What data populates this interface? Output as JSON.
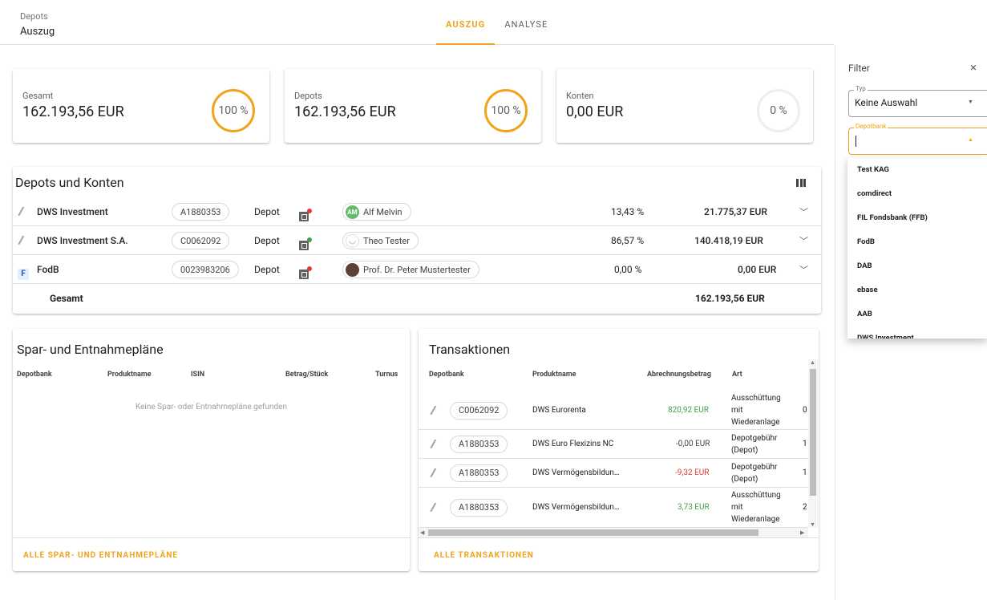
{
  "header": {
    "breadcrumb_small": "Depots",
    "breadcrumb_title": "Auszug",
    "tabs": [
      {
        "label": "AUSZUG",
        "active": true
      },
      {
        "label": "ANALYSE",
        "active": false
      }
    ]
  },
  "summary": [
    {
      "label": "Gesamt",
      "value": "162.193,56 EUR",
      "percent_label": "100 %"
    },
    {
      "label": "Depots",
      "value": "162.193,56 EUR",
      "percent_label": "100 %"
    },
    {
      "label": "Konten",
      "value": "0,00 EUR",
      "percent_label": "0 %"
    }
  ],
  "depots": {
    "title": "Depots und Konten",
    "rows": [
      {
        "name": "DWS Investment",
        "id": "A1880353",
        "type": "Depot",
        "status_color": "#e53935",
        "owner": "Alf Melvin",
        "owner_initials": "AM",
        "percent": "13,43 %",
        "amount": "21.775,37 EUR",
        "icon": "slash-icon"
      },
      {
        "name": "DWS Investment S.A.",
        "id": "C0062092",
        "type": "Depot",
        "status_color": "#43a047",
        "owner": "Theo Tester",
        "owner_initials": "◡",
        "percent": "86,57 %",
        "amount": "140.418,19 EUR",
        "icon": "slash-icon"
      },
      {
        "name": "FodB",
        "id": "0023983206",
        "type": "Depot",
        "status_color": "#e53935",
        "owner": "Prof. Dr. Peter Mustertester",
        "owner_initials": "",
        "percent": "0,00 %",
        "amount": "0,00 EUR",
        "icon": "f-icon",
        "icon_letter": "F"
      }
    ],
    "total_label": "Gesamt",
    "total_amount": "162.193,56 EUR"
  },
  "spar": {
    "title": "Spar- und Entnahmepläne",
    "columns": [
      "Depotbank",
      "Produktname",
      "ISIN",
      "Betrag/Stück",
      "Turnus"
    ],
    "empty_message": "Keine Spar- oder Entnahmepläne gefunden",
    "footer_link": "ALLE SPAR- UND ENTNAHMEPLÄNE"
  },
  "transactions": {
    "title": "Transaktionen",
    "columns": [
      "Depotbank",
      "Produktname",
      "Abrechnungsbetrag",
      "Art"
    ],
    "rows": [
      {
        "depot": "C0062092",
        "product": "DWS Eurorenta",
        "amount": "820,92 EUR",
        "amount_color": "#43a047",
        "art": [
          "Ausschüttung",
          "mit",
          "Wiederanlage"
        ],
        "extra": "0"
      },
      {
        "depot": "A1880353",
        "product": "DWS Euro Flexizins NC",
        "amount": "-0,00 EUR",
        "amount_color": "#424242",
        "art": [
          "Depotgebühr",
          "(Depot)"
        ],
        "extra": "1"
      },
      {
        "depot": "A1880353",
        "product": "DWS Vermögensbildun…",
        "amount": "-9,32 EUR",
        "amount_color": "#e53935",
        "art": [
          "Depotgebühr",
          "(Depot)"
        ],
        "extra": "1"
      },
      {
        "depot": "A1880353",
        "product": "DWS Vermögensbildun…",
        "amount": "3,73 EUR",
        "amount_color": "#43a047",
        "art": [
          "Ausschüttung",
          "mit",
          "Wiederanlage"
        ],
        "extra": "2"
      }
    ],
    "footer_link": "ALLE TRANSAKTIONEN"
  },
  "filter": {
    "title": "Filter",
    "close_icon": "×",
    "typ_label": "Typ",
    "typ_value": "Keine Auswahl",
    "depotbank_label": "Depotbank",
    "depotbank_value": "",
    "depotbank_options": [
      "Test KAG",
      "comdirect",
      "FIL Fondsbank (FFB)",
      "FodB",
      "DAB",
      "ebase",
      "AAB",
      "DWS Investment"
    ]
  },
  "colors": {
    "accent": "#f2a31b",
    "positive": "#43a047",
    "negative": "#e53935"
  }
}
